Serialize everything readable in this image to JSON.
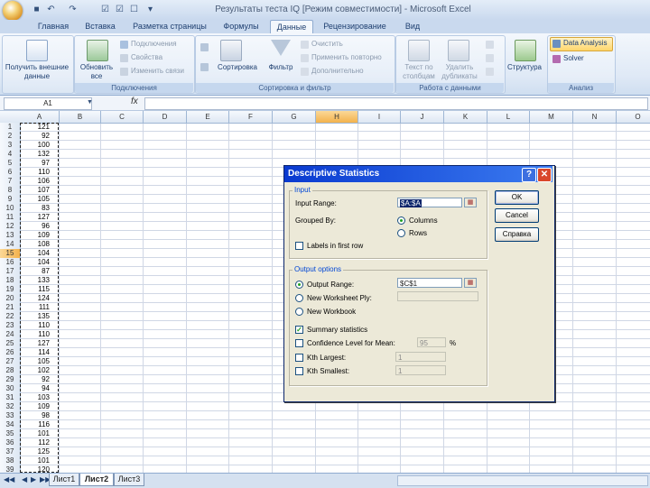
{
  "window": {
    "title": "Результаты теста IQ  [Режим совместимости] - Microsoft Excel"
  },
  "qat": [
    "save-icon",
    "undo-icon",
    "redo-icon",
    "checkbox-icon",
    "checkbox-icon",
    "checkbox-icon"
  ],
  "tabs": [
    "Главная",
    "Вставка",
    "Разметка страницы",
    "Формулы",
    "Данные",
    "Рецензирование",
    "Вид"
  ],
  "active_tab": "Данные",
  "ribbon": {
    "get_external": "Получить внешние данные",
    "refresh_all": "Обновить все",
    "connections": "Подключения",
    "properties": "Свойства",
    "edit_links": "Изменить связи",
    "group_connections": "Подключения",
    "sort": "Сортировка",
    "filter": "Фильтр",
    "clear": "Очистить",
    "reapply": "Применить повторно",
    "advanced": "Дополнительно",
    "group_sort": "Сортировка и фильтр",
    "text_to_columns": "Текст по столбцам",
    "remove_duplicates": "Удалить дубликаты",
    "group_data_tools": "Работа с данными",
    "outline": "Структура",
    "data_analysis": "Data Analysis",
    "solver": "Solver",
    "group_analysis": "Анализ"
  },
  "formula_bar": {
    "namebox": "A1",
    "fx": "fx",
    "content": ""
  },
  "columns": [
    "A",
    "B",
    "C",
    "D",
    "E",
    "F",
    "G",
    "H",
    "I",
    "J",
    "K",
    "L",
    "M",
    "N",
    "O"
  ],
  "selected_column": "H",
  "rows": [
    "1",
    "2",
    "3",
    "4",
    "5",
    "6",
    "7",
    "8",
    "9",
    "10",
    "11",
    "12",
    "13",
    "14",
    "15",
    "16",
    "17",
    "18",
    "19",
    "20",
    "21",
    "22",
    "23",
    "24",
    "25",
    "26",
    "27",
    "28",
    "29",
    "30",
    "31",
    "32",
    "33",
    "34",
    "35",
    "36",
    "37",
    "38",
    "39"
  ],
  "selected_row": "15",
  "column_a_values": [
    "121",
    "92",
    "100",
    "132",
    "97",
    "110",
    "106",
    "107",
    "105",
    "83",
    "127",
    "96",
    "109",
    "108",
    "104",
    "104",
    "87",
    "133",
    "115",
    "124",
    "111",
    "135",
    "110",
    "110",
    "127",
    "114",
    "105",
    "102",
    "92",
    "94",
    "103",
    "109",
    "98",
    "116",
    "101",
    "112",
    "125",
    "101",
    "120"
  ],
  "sheet_tabs": [
    "Лист1",
    "Лист2",
    "Лист3"
  ],
  "active_sheet": "Лист2",
  "dialog": {
    "title": "Descriptive Statistics",
    "input_section": "Input",
    "input_range_label": "Input Range:",
    "input_range_value": "$A:$A",
    "grouped_by_label": "Grouped By:",
    "columns_option": "Columns",
    "rows_option": "Rows",
    "grouped_by_selected": "Columns",
    "labels_first_row": "Labels in first row",
    "labels_first_row_checked": false,
    "output_section": "Output options",
    "output_range_label": "Output Range:",
    "output_range_value": "$C$1",
    "new_worksheet_label": "New Worksheet Ply:",
    "new_workbook_label": "New Workbook",
    "output_selected": "Output Range",
    "summary_statistics": "Summary statistics",
    "summary_checked": true,
    "confidence_label": "Confidence Level for Mean:",
    "confidence_value": "95",
    "confidence_unit": "%",
    "confidence_checked": false,
    "kth_largest": "Kth Largest:",
    "kth_largest_value": "1",
    "kth_smallest": "Kth Smallest:",
    "kth_smallest_value": "1",
    "ok": "OK",
    "cancel": "Cancel",
    "help": "Справка"
  }
}
